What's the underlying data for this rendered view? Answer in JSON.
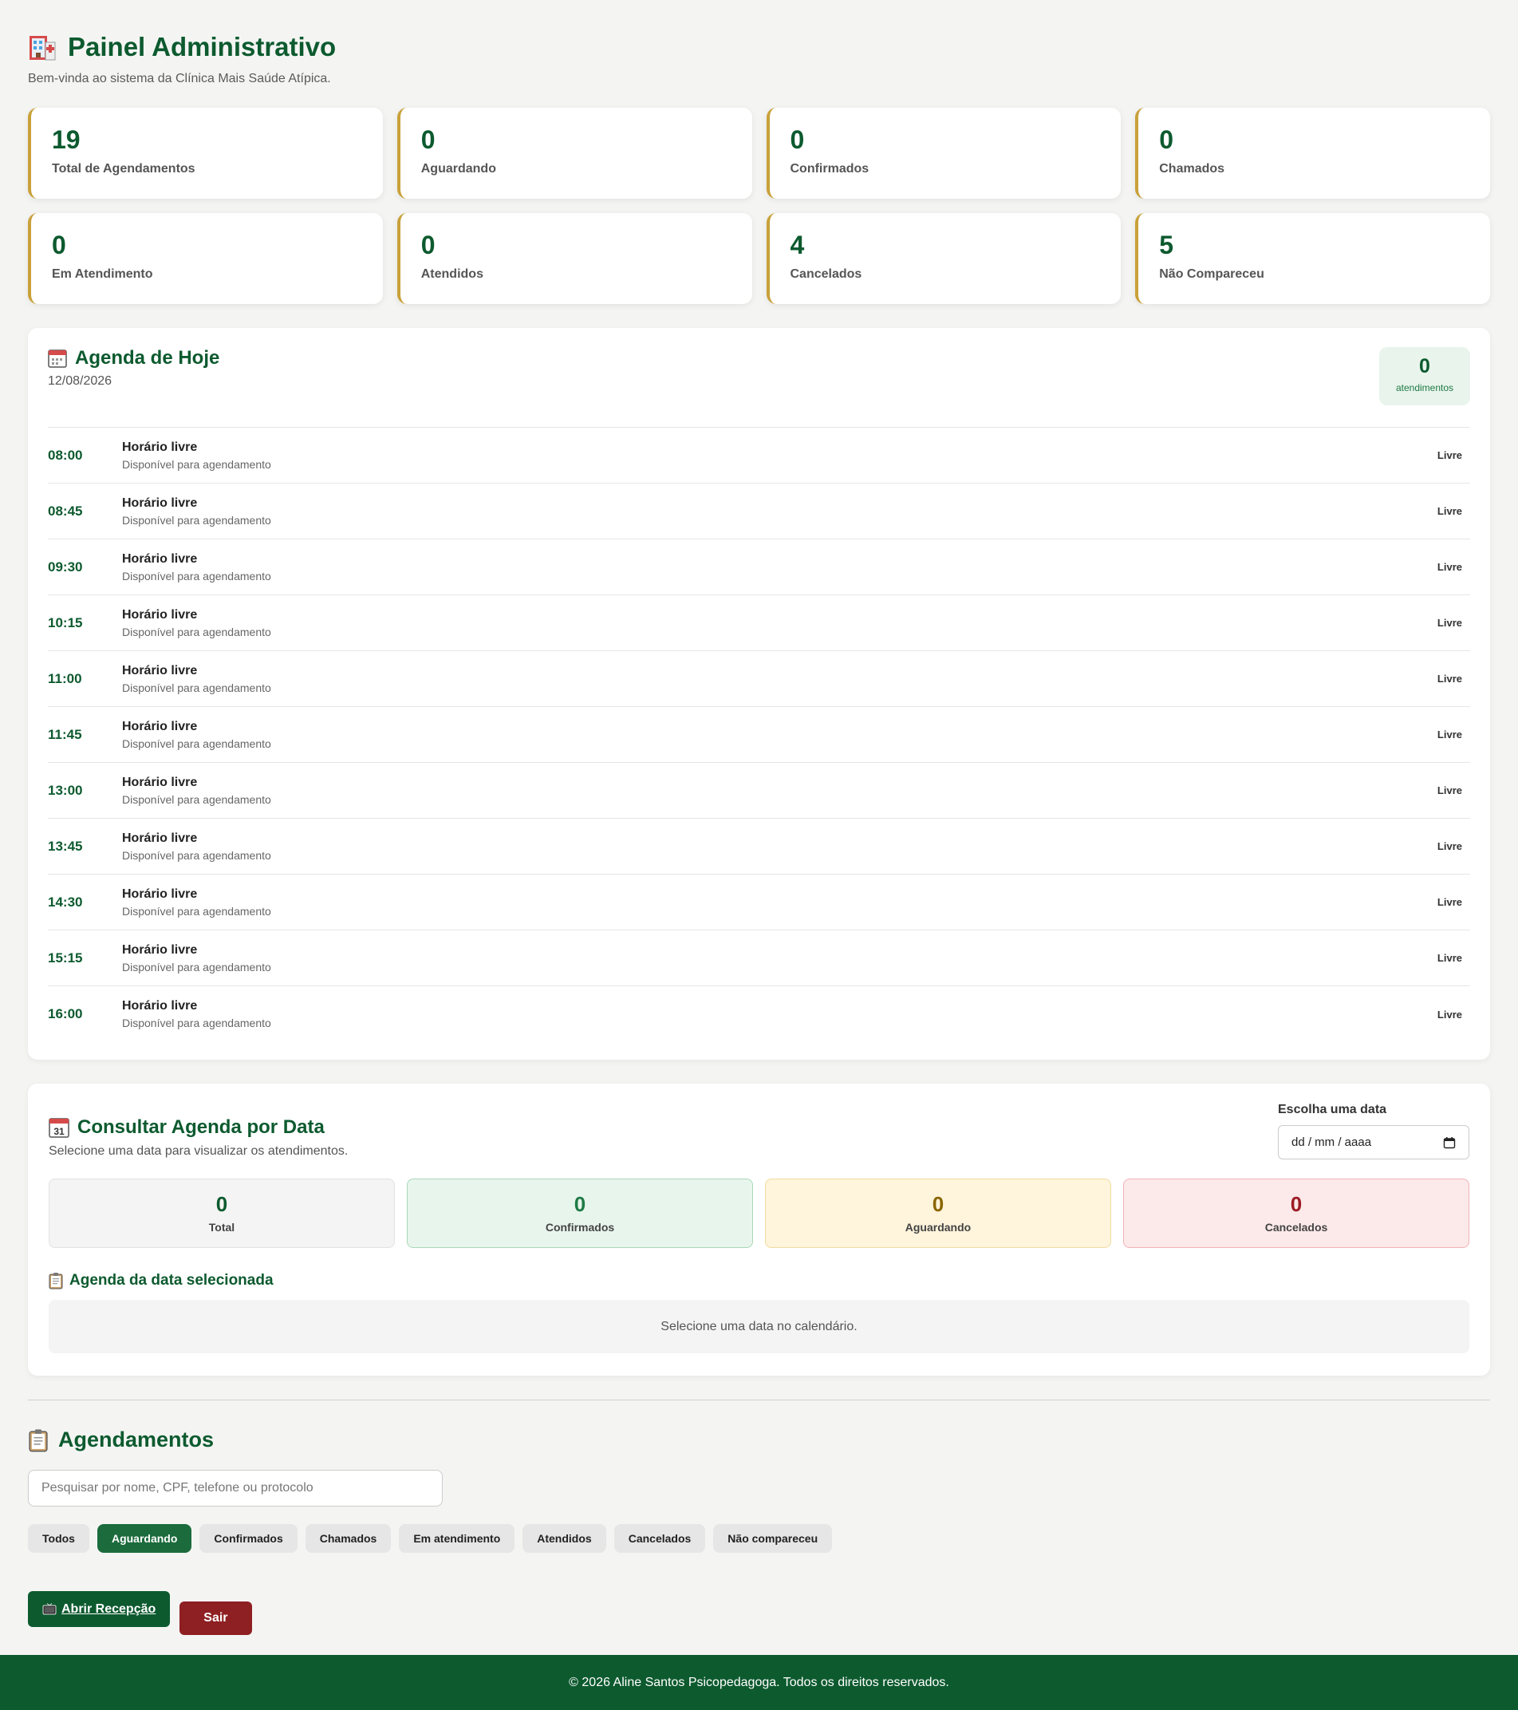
{
  "header": {
    "title": "Painel Administrativo",
    "subtitle": "Bem-vinda ao sistema da Clínica Mais Saúde Atípica."
  },
  "stats": [
    {
      "value": "19",
      "label": "Total de Agendamentos"
    },
    {
      "value": "0",
      "label": "Aguardando"
    },
    {
      "value": "0",
      "label": "Confirmados"
    },
    {
      "value": "0",
      "label": "Chamados"
    },
    {
      "value": "0",
      "label": "Em Atendimento"
    },
    {
      "value": "0",
      "label": "Atendidos"
    },
    {
      "value": "4",
      "label": "Cancelados"
    },
    {
      "value": "5",
      "label": "Não Compareceu"
    }
  ],
  "today": {
    "title": "Agenda de Hoje",
    "date": "12/08/2026",
    "count": "0",
    "count_label": "atendimentos",
    "slots": [
      {
        "time": "08:00",
        "title": "Horário livre",
        "desc": "Disponível para agendamento",
        "status": "Livre"
      },
      {
        "time": "08:45",
        "title": "Horário livre",
        "desc": "Disponível para agendamento",
        "status": "Livre"
      },
      {
        "time": "09:30",
        "title": "Horário livre",
        "desc": "Disponível para agendamento",
        "status": "Livre"
      },
      {
        "time": "10:15",
        "title": "Horário livre",
        "desc": "Disponível para agendamento",
        "status": "Livre"
      },
      {
        "time": "11:00",
        "title": "Horário livre",
        "desc": "Disponível para agendamento",
        "status": "Livre"
      },
      {
        "time": "11:45",
        "title": "Horário livre",
        "desc": "Disponível para agendamento",
        "status": "Livre"
      },
      {
        "time": "13:00",
        "title": "Horário livre",
        "desc": "Disponível para agendamento",
        "status": "Livre"
      },
      {
        "time": "13:45",
        "title": "Horário livre",
        "desc": "Disponível para agendamento",
        "status": "Livre"
      },
      {
        "time": "14:30",
        "title": "Horário livre",
        "desc": "Disponível para agendamento",
        "status": "Livre"
      },
      {
        "time": "15:15",
        "title": "Horário livre",
        "desc": "Disponível para agendamento",
        "status": "Livre"
      },
      {
        "time": "16:00",
        "title": "Horário livre",
        "desc": "Disponível para agendamento",
        "status": "Livre"
      }
    ]
  },
  "consult": {
    "title": "Consultar Agenda por Data",
    "subtitle": "Selecione uma data para visualizar os atendimentos.",
    "date_label": "Escolha uma data",
    "date_placeholder": "dd / mm / aaaa",
    "summary": [
      {
        "value": "0",
        "label": "Total"
      },
      {
        "value": "0",
        "label": "Confirmados"
      },
      {
        "value": "0",
        "label": "Aguardando"
      },
      {
        "value": "0",
        "label": "Cancelados"
      }
    ],
    "selected_title": "Agenda da data selecionada",
    "empty_text": "Selecione uma data no calendário."
  },
  "appointments": {
    "title": "Agendamentos",
    "search_placeholder": "Pesquisar por nome, CPF, telefone ou protocolo",
    "filters": [
      "Todos",
      "Aguardando",
      "Confirmados",
      "Chamados",
      "Em atendimento",
      "Atendidos",
      "Cancelados",
      "Não compareceu"
    ],
    "active_filter": "Aguardando"
  },
  "actions": {
    "reception": "Abrir Recepção",
    "logout": "Sair"
  },
  "footer": {
    "text": "© 2026 Aline Santos Psicopedagoga. Todos os direitos reservados."
  },
  "colors": {
    "brand_green": "#0d5a2f",
    "accent_gold": "#c9a13a",
    "danger": "#8e1f22"
  }
}
